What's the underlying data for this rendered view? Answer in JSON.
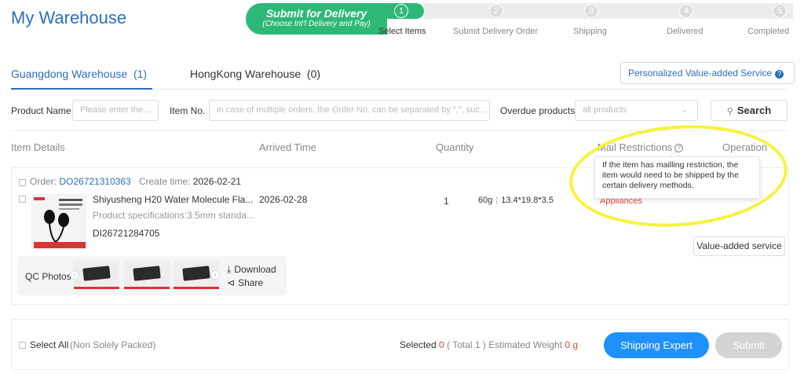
{
  "header": {
    "title": "My Warehouse",
    "submit_main": "Submit for Delivery",
    "submit_sub": "(Choose Int'l Delivery and Pay)",
    "steps": [
      {
        "num": "1",
        "label": "Select Items",
        "done": true
      },
      {
        "num": "2",
        "label": "Submit Delivery Order",
        "done": false
      },
      {
        "num": "3",
        "label": "Shipping",
        "done": false
      },
      {
        "num": "4",
        "label": "Delivered",
        "done": false
      },
      {
        "num": "5",
        "label": "Completed",
        "done": false
      }
    ]
  },
  "tabs": [
    {
      "label": "Guangdong Warehouse",
      "count": "(1)"
    },
    {
      "label": "HongKong Warehouse",
      "count": "(0)"
    }
  ],
  "vas_button": {
    "label": "Personalized Value-added Service",
    "icon": "help-circle-icon"
  },
  "filters": {
    "product_name_label": "Product Name",
    "product_name_placeholder": "Please enter the ...",
    "item_no_label": "Item No.",
    "item_no_placeholder": "in case of multiple orders, the Order No. can be separated by \",\", suc...",
    "overdue_label": "Overdue products",
    "overdue_value": "all products",
    "search_label": "Search"
  },
  "table_headers": {
    "item_details": "Item Details",
    "arrived_time": "Arrived Time",
    "quantity": "Quantity",
    "mail_restrictions": "Mail Restrictions",
    "operation": "Operation"
  },
  "order": {
    "order_prefix": "Order:",
    "order_no": "DO26721310363",
    "create_time_label": "Create time:",
    "create_time": "2026-02-21",
    "product_name": "Shiyusheng H20 Water Molecule Fla...",
    "spec": "Product specifications:3.5mm standa...",
    "item_id": "DI26721284705",
    "arrived": "2026-02-28",
    "quantity": "1",
    "weight": "60g",
    "dimensions": "13.4*19.8*3.5",
    "restriction": "Appliances",
    "vas_label": "Value-added service",
    "qc_label": "QC Photos",
    "download_label": "Download",
    "share_label": "Share"
  },
  "tooltip": {
    "text": "If the item has mailling restriction, the item would need to be shipped by the certain delivery methods."
  },
  "footer": {
    "select_all": "Select All",
    "non_solely": "(Non Solely Packed)",
    "selected_label": "Selected",
    "selected_count": "0",
    "total": "( Total 1 )",
    "est_weight_label": "Estimated Weight",
    "est_weight": "0 g",
    "shipping_expert": "Shipping Expert",
    "submit": "Submit"
  },
  "colors": {
    "brand_blue": "#2a6fbd",
    "green": "#2eb877",
    "red": "#e04a3f",
    "button_blue": "#1e90ff",
    "highlight": "#f7f23a"
  }
}
